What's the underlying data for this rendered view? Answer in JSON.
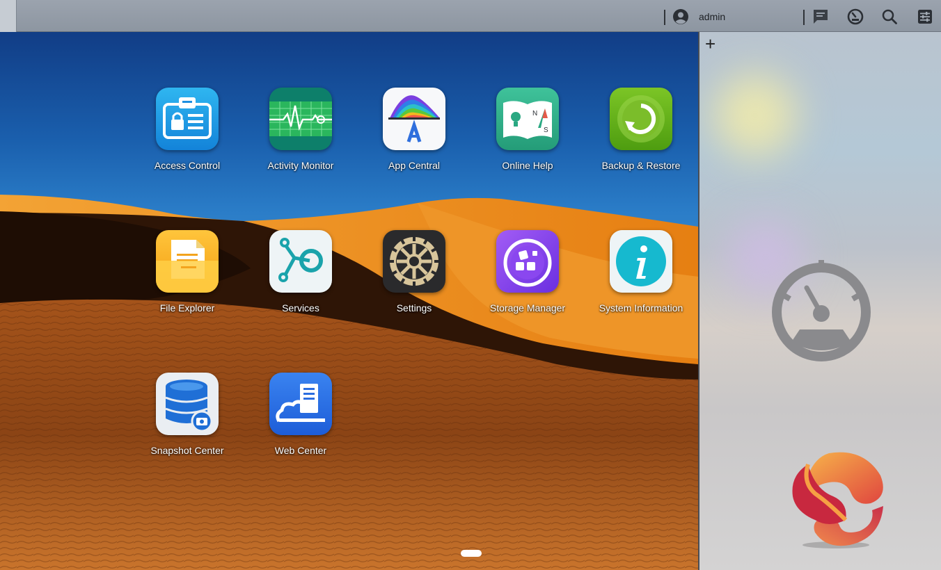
{
  "topbar": {
    "user": "admin",
    "icons": [
      "user-icon",
      "notification-icon",
      "dashboard-icon",
      "search-icon",
      "settings-sliders-icon"
    ]
  },
  "desktop": {
    "apps": [
      {
        "label": "Access Control",
        "icon": "access-control-icon"
      },
      {
        "label": "Activity Monitor",
        "icon": "activity-monitor-icon"
      },
      {
        "label": "App Central",
        "icon": "app-central-icon"
      },
      {
        "label": "Online Help",
        "icon": "online-help-icon"
      },
      {
        "label": "Backup & Restore",
        "icon": "backup-restore-icon"
      },
      {
        "label": "File Explorer",
        "icon": "file-explorer-icon"
      },
      {
        "label": "Services",
        "icon": "services-icon"
      },
      {
        "label": "Settings",
        "icon": "settings-gear-icon"
      },
      {
        "label": "Storage Manager",
        "icon": "storage-manager-icon"
      },
      {
        "label": "System Information",
        "icon": "system-information-icon"
      },
      {
        "label": "Snapshot Center",
        "icon": "snapshot-center-icon"
      },
      {
        "label": "Web Center",
        "icon": "web-center-icon"
      }
    ],
    "pages": {
      "current": 1,
      "total": 1
    }
  },
  "panel": {
    "add_label": "+",
    "widget_icon": "gauge-icon",
    "logo": "brand-logo"
  },
  "colors": {
    "topbar": "#939ca6",
    "sky": "#2a7cc7",
    "dune": "#e8891f",
    "panel": "#c4c8cf"
  }
}
